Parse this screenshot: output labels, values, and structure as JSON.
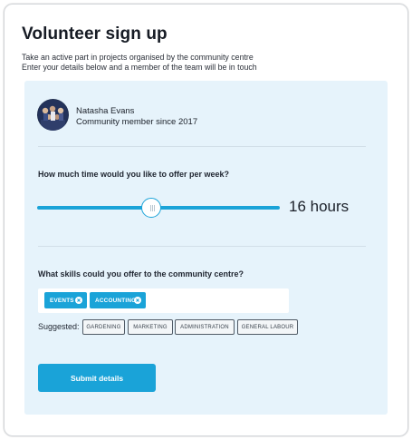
{
  "page": {
    "title": "Volunteer sign up",
    "subtitle_line1": "Take an active part in projects organised by the community centre",
    "subtitle_line2": "Enter your details below and a member of the team will be in touch"
  },
  "profile": {
    "name": "Natasha Evans",
    "member_since": "Community member since 2017"
  },
  "time": {
    "question": "How much time would you like to offer per week?",
    "hours_label": "16 hours",
    "slider_fraction": 0.47
  },
  "skills": {
    "question": "What skills could you offer to the community centre?",
    "selected": [
      "EVENTS",
      "ACCOUNTING"
    ],
    "suggested_label": "Suggested:",
    "suggested": [
      "GARDENING",
      "MARKETING",
      "ADMINISTRATION",
      "GENERAL LABOUR"
    ]
  },
  "actions": {
    "submit_label": "Submit details"
  },
  "colors": {
    "accent": "#1aa3d8",
    "panel": "#e6f3fb",
    "text": "#1f2530"
  },
  "icons": {
    "chip_remove": "x-circle-icon",
    "slider_grip": "grip-lines-icon"
  }
}
